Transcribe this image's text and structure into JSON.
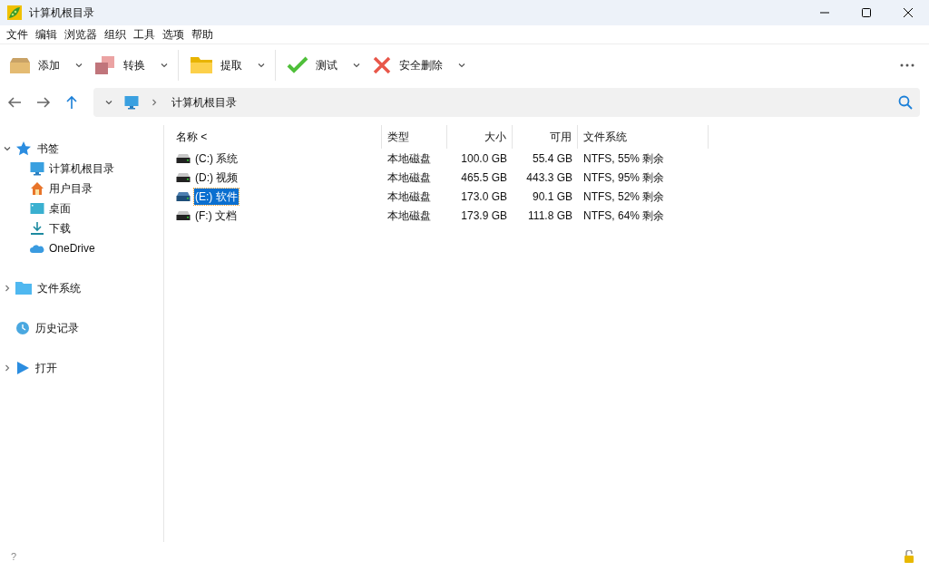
{
  "window": {
    "title": "计算机根目录"
  },
  "menu": [
    "文件",
    "编辑",
    "浏览器",
    "组织",
    "工具",
    "选项",
    "帮助"
  ],
  "toolbar": [
    [
      {
        "label": "添加"
      },
      {
        "label": "转换"
      }
    ],
    [
      {
        "label": "提取"
      }
    ],
    [
      {
        "label": "测试"
      },
      {
        "label": "安全删除"
      }
    ]
  ],
  "address": {
    "path": "计算机根目录"
  },
  "sidebar": [
    {
      "kind": "group",
      "label": "书签",
      "expanded": true,
      "children": [
        {
          "label": "计算机根目录"
        },
        {
          "label": "用户目录"
        },
        {
          "label": "桌面"
        },
        {
          "label": "下载"
        },
        {
          "label": "OneDrive"
        }
      ]
    },
    {
      "kind": "group",
      "label": "文件系统",
      "expanded": false
    },
    {
      "kind": "item",
      "label": "历史记录"
    },
    {
      "kind": "group",
      "label": "打开",
      "expanded": false
    }
  ],
  "table": {
    "columns": [
      "名称 <",
      "类型",
      "大小",
      "可用",
      "文件系统"
    ],
    "rows": [
      {
        "name": "(C:) 系统",
        "type": "本地磁盘",
        "size": "100.0 GB",
        "free": "55.4 GB",
        "fs": "NTFS, 55% 剩余",
        "selected": false
      },
      {
        "name": "(D:) 视频",
        "type": "本地磁盘",
        "size": "465.5 GB",
        "free": "443.3 GB",
        "fs": "NTFS, 95% 剩余",
        "selected": false
      },
      {
        "name": "(E:) 软件",
        "type": "本地磁盘",
        "size": "173.0 GB",
        "free": "90.1 GB",
        "fs": "NTFS, 52% 剩余",
        "selected": true
      },
      {
        "name": "(F:) 文档",
        "type": "本地磁盘",
        "size": "173.9 GB",
        "free": "111.8 GB",
        "fs": "NTFS, 64% 剩余",
        "selected": false
      }
    ]
  },
  "status_bar": {
    "help": "?"
  }
}
